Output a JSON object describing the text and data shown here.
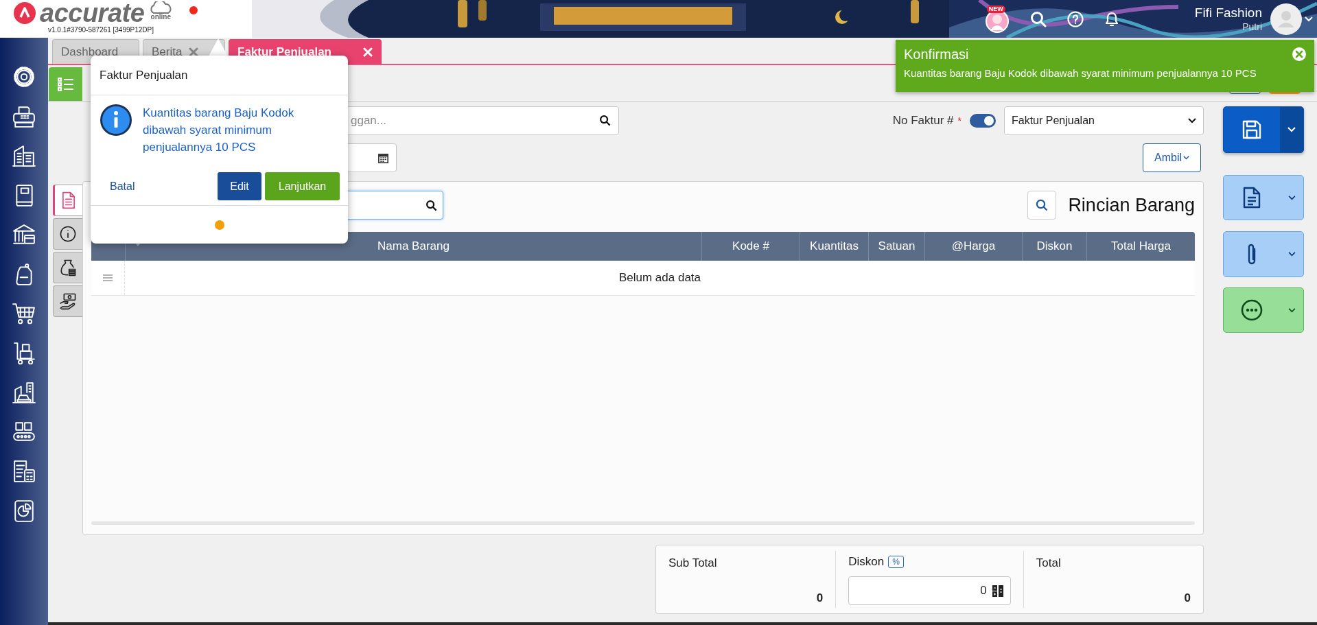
{
  "header": {
    "logo": "accurate",
    "logo_sub": "online",
    "version": "v1.0.1#3790-587261 [3499P12DP]",
    "new_badge": "NEW",
    "company": "Fifi Fashion",
    "user": "Putri"
  },
  "tabs": [
    {
      "label": "Dashboard",
      "selected": false,
      "closable": false
    },
    {
      "label": "Berita",
      "selected": false,
      "closable": true
    },
    {
      "label": "Faktur Penjualan",
      "selected": true,
      "closable": true
    }
  ],
  "side_tabs": [
    {
      "selected": true
    },
    {
      "selected": false
    },
    {
      "selected": false
    },
    {
      "selected": false
    }
  ],
  "form": {
    "customer_placeholder": "ggan...",
    "no_faktur_label": "No Faktur #",
    "required_mark": "*",
    "auto_number": true,
    "type_select": "Faktur Penjualan",
    "ambil_button": "Ambil"
  },
  "items_panel": {
    "title": "Rincian Barang",
    "columns": [
      "Nama Barang",
      "Kode #",
      "Kuantitas",
      "Satuan",
      "@Harga",
      "Diskon",
      "Total Harga"
    ],
    "empty_text": "Belum ada data"
  },
  "totals": {
    "sub_total_label": "Sub Total",
    "sub_total": "0",
    "diskon_label": "Diskon",
    "percent_badge": "%",
    "diskon_value": "0",
    "total_label": "Total",
    "total": "0"
  },
  "popup": {
    "title": "Faktur Penjualan",
    "message": "Kuantitas barang Baju Kodok dibawah syarat minimum penjualannya 10 PCS",
    "buttons": [
      {
        "label": "Batal",
        "kind": "link"
      },
      {
        "label": "Edit",
        "kind": "primary"
      },
      {
        "label": "Lanjutkan",
        "kind": "success"
      }
    ]
  },
  "toast": {
    "title": "Konfirmasi",
    "message": "Kuantitas barang Baju Kodok dibawah syarat minimum penjualannya 10 PCS"
  }
}
